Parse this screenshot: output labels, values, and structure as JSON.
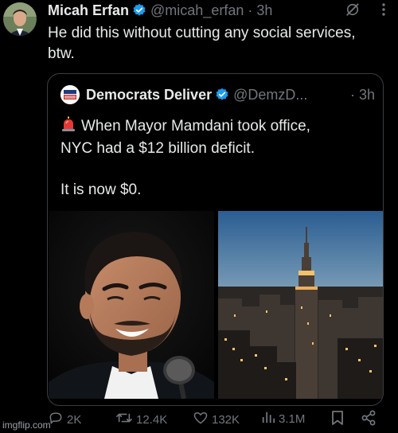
{
  "post": {
    "author_name": "Micah Erfan",
    "author_handle": "@micah_erfan · 3h",
    "text": "He did this without cutting any social services, btw."
  },
  "quote": {
    "author_name": "Democrats Deliver",
    "author_handle": "@DemzD...",
    "time": "· 3h",
    "logo_text": "DEMS DELIVER",
    "line1": "When Mayor Mamdani took office,",
    "line2": "NYC had a $12 billion deficit.",
    "line3": "It is now $0."
  },
  "actions": {
    "replies": "2K",
    "reposts": "12.4K",
    "likes": "132K",
    "views": "3.1M"
  },
  "watermark": "imgflip.com",
  "colors": {
    "background": "#000000",
    "text": "#e7e9ea",
    "muted": "#71767b",
    "verified": "#1d9bf0",
    "border": "#3a3d40"
  },
  "icons": [
    "verified-badge-icon",
    "grok-icon",
    "more-icon",
    "siren-icon",
    "reply-icon",
    "repost-icon",
    "like-icon",
    "views-icon",
    "bookmark-icon",
    "share-icon"
  ]
}
